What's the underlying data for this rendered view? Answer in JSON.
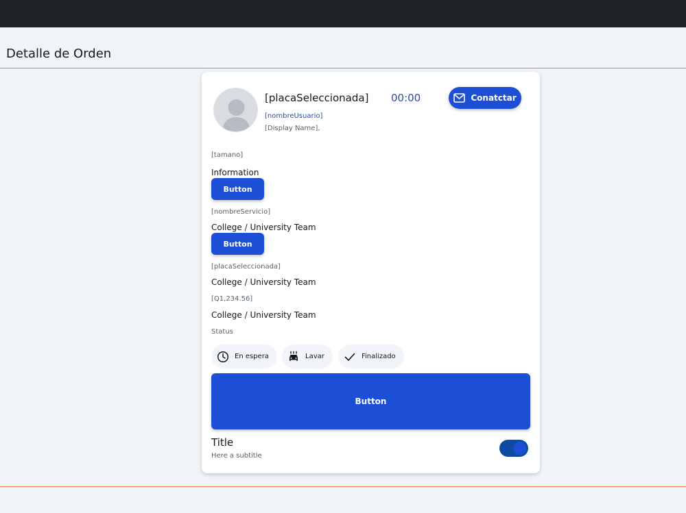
{
  "page": {
    "title": "Detalle de Orden"
  },
  "header": {
    "plate": "[placaSeleccionada]",
    "timer": "00:00",
    "contact_label": "Conatctar",
    "username": "[nombreUsuario]",
    "display_name": "[Display Name],"
  },
  "details": [
    {
      "label": "[tamano]",
      "value": "Information",
      "button": "Button"
    },
    {
      "label": "[nombreServicio]",
      "value": "College / University Team",
      "button": "Button"
    },
    {
      "label": "[placaSeleccionada]",
      "value": "College / University Team"
    },
    {
      "label": "[Q1,234.56]",
      "value": "College / University Team"
    }
  ],
  "status": {
    "label": "Status",
    "chips": [
      {
        "label": "En espera",
        "icon": "clock-icon"
      },
      {
        "label": "Lavar",
        "icon": "car-wash-icon"
      },
      {
        "label": "Finalizado",
        "icon": "check-icon"
      }
    ]
  },
  "main_button": "Button",
  "footer": {
    "title": "Title",
    "subtitle": "Here a subtitle",
    "toggle_on": true
  },
  "colors": {
    "primary": "#1c4fd6",
    "accent_line": "#f07a55",
    "topbar": "#1e2328",
    "background": "#f1f4f8"
  }
}
